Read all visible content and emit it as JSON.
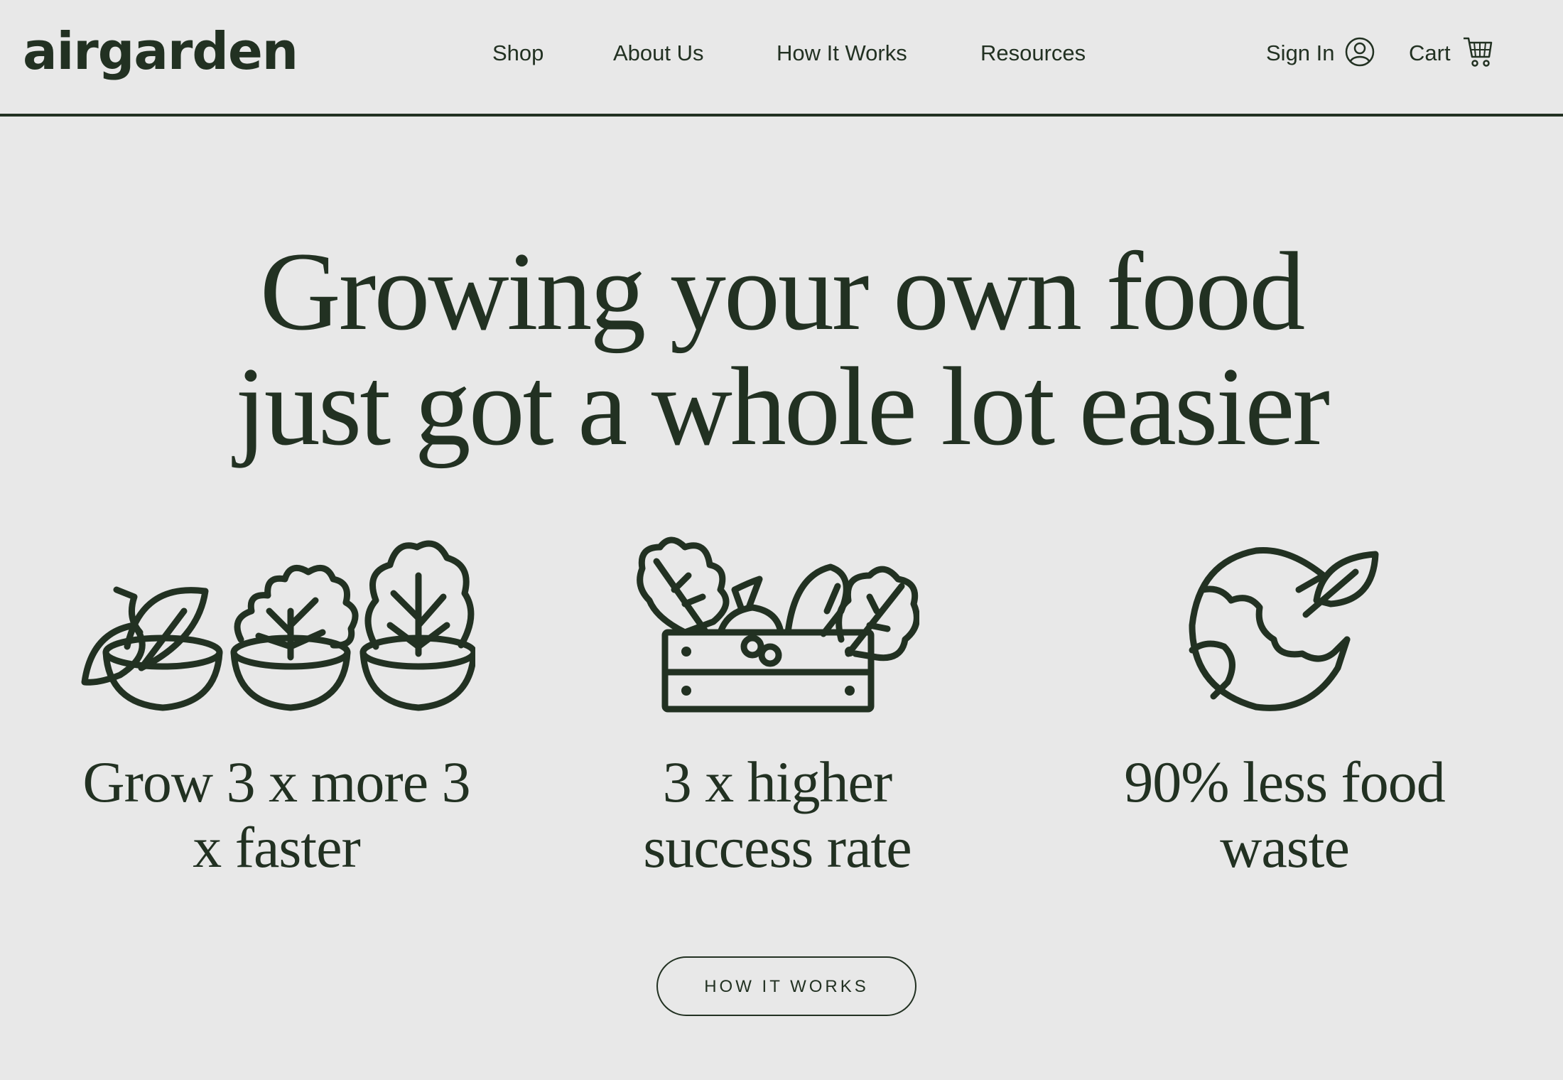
{
  "brand": {
    "logo_text": "airgarden",
    "color_primary": "#223122",
    "color_background": "#e8e8e8"
  },
  "nav": {
    "items": [
      {
        "label": "Shop"
      },
      {
        "label": "About Us"
      },
      {
        "label": "How It Works"
      },
      {
        "label": "Resources"
      }
    ]
  },
  "account": {
    "sign_in_label": "Sign In",
    "sign_in_icon": "user-circle-icon",
    "cart_label": "Cart",
    "cart_icon": "shopping-cart-icon"
  },
  "hero": {
    "title_line_1": "Growing your own food",
    "title_line_2": "just got a whole lot easier"
  },
  "features": [
    {
      "icon": "potted-plants-icon",
      "line_1": "Grow 3 x more 3",
      "line_2": "x faster"
    },
    {
      "icon": "vegetable-crate-icon",
      "line_1": "3 x higher",
      "line_2": "success rate"
    },
    {
      "icon": "earth-leaf-icon",
      "line_1": "90% less food",
      "line_2": "waste"
    }
  ],
  "cta": {
    "label": "HOW IT WORKS"
  }
}
